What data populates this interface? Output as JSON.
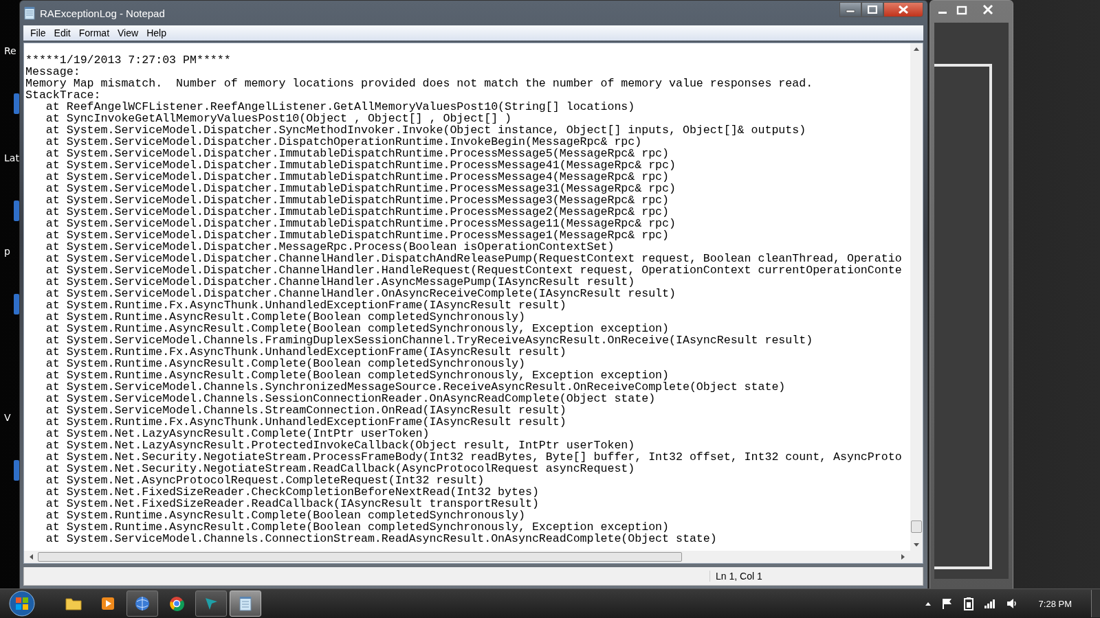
{
  "window": {
    "title": "RAExceptionLog - Notepad"
  },
  "menu": [
    "File",
    "Edit",
    "Format",
    "View",
    "Help"
  ],
  "lines": [
    "*****1/19/2013 7:27:03 PM*****",
    "Message:",
    "Memory Map mismatch.  Number of memory locations provided does not match the number of memory value responses read.",
    "StackTrace:",
    "   at ReefAngelWCFListener.ReefAngelListener.GetAllMemoryValuesPost10(String[] locations)",
    "   at SyncInvokeGetAllMemoryValuesPost10(Object , Object[] , Object[] )",
    "   at System.ServiceModel.Dispatcher.SyncMethodInvoker.Invoke(Object instance, Object[] inputs, Object[]& outputs)",
    "   at System.ServiceModel.Dispatcher.DispatchOperationRuntime.InvokeBegin(MessageRpc& rpc)",
    "   at System.ServiceModel.Dispatcher.ImmutableDispatchRuntime.ProcessMessage5(MessageRpc& rpc)",
    "   at System.ServiceModel.Dispatcher.ImmutableDispatchRuntime.ProcessMessage41(MessageRpc& rpc)",
    "   at System.ServiceModel.Dispatcher.ImmutableDispatchRuntime.ProcessMessage4(MessageRpc& rpc)",
    "   at System.ServiceModel.Dispatcher.ImmutableDispatchRuntime.ProcessMessage31(MessageRpc& rpc)",
    "   at System.ServiceModel.Dispatcher.ImmutableDispatchRuntime.ProcessMessage3(MessageRpc& rpc)",
    "   at System.ServiceModel.Dispatcher.ImmutableDispatchRuntime.ProcessMessage2(MessageRpc& rpc)",
    "   at System.ServiceModel.Dispatcher.ImmutableDispatchRuntime.ProcessMessage11(MessageRpc& rpc)",
    "   at System.ServiceModel.Dispatcher.ImmutableDispatchRuntime.ProcessMessage1(MessageRpc& rpc)",
    "   at System.ServiceModel.Dispatcher.MessageRpc.Process(Boolean isOperationContextSet)",
    "   at System.ServiceModel.Dispatcher.ChannelHandler.DispatchAndReleasePump(RequestContext request, Boolean cleanThread, Operatio",
    "   at System.ServiceModel.Dispatcher.ChannelHandler.HandleRequest(RequestContext request, OperationContext currentOperationConte",
    "   at System.ServiceModel.Dispatcher.ChannelHandler.AsyncMessagePump(IAsyncResult result)",
    "   at System.ServiceModel.Dispatcher.ChannelHandler.OnAsyncReceiveComplete(IAsyncResult result)",
    "   at System.Runtime.Fx.AsyncThunk.UnhandledExceptionFrame(IAsyncResult result)",
    "   at System.Runtime.AsyncResult.Complete(Boolean completedSynchronously)",
    "   at System.Runtime.AsyncResult.Complete(Boolean completedSynchronously, Exception exception)",
    "   at System.ServiceModel.Channels.FramingDuplexSessionChannel.TryReceiveAsyncResult.OnReceive(IAsyncResult result)",
    "   at System.Runtime.Fx.AsyncThunk.UnhandledExceptionFrame(IAsyncResult result)",
    "   at System.Runtime.AsyncResult.Complete(Boolean completedSynchronously)",
    "   at System.Runtime.AsyncResult.Complete(Boolean completedSynchronously, Exception exception)",
    "   at System.ServiceModel.Channels.SynchronizedMessageSource.ReceiveAsyncResult.OnReceiveComplete(Object state)",
    "   at System.ServiceModel.Channels.SessionConnectionReader.OnAsyncReadComplete(Object state)",
    "   at System.ServiceModel.Channels.StreamConnection.OnRead(IAsyncResult result)",
    "   at System.Runtime.Fx.AsyncThunk.UnhandledExceptionFrame(IAsyncResult result)",
    "   at System.Net.LazyAsyncResult.Complete(IntPtr userToken)",
    "   at System.Net.LazyAsyncResult.ProtectedInvokeCallback(Object result, IntPtr userToken)",
    "   at System.Net.Security.NegotiateStream.ProcessFrameBody(Int32 readBytes, Byte[] buffer, Int32 offset, Int32 count, AsyncProto",
    "   at System.Net.Security.NegotiateStream.ReadCallback(AsyncProtocolRequest asyncRequest)",
    "   at System.Net.AsyncProtocolRequest.CompleteRequest(Int32 result)",
    "   at System.Net.FixedSizeReader.CheckCompletionBeforeNextRead(Int32 bytes)",
    "   at System.Net.FixedSizeReader.ReadCallback(IAsyncResult transportResult)",
    "   at System.Runtime.AsyncResult.Complete(Boolean completedSynchronously)",
    "   at System.Runtime.AsyncResult.Complete(Boolean completedSynchronously, Exception exception)",
    "   at System.ServiceModel.Channels.ConnectionStream.ReadAsyncResult.OnAsyncReadComplete(Object state)"
  ],
  "status_bar": {
    "position": "Ln 1, Col 1"
  },
  "desktop_labels": [
    "Re",
    "Lat",
    "p",
    "V"
  ],
  "taskbar": {
    "apps": [
      {
        "kind": "folder",
        "running": false,
        "selected": false
      },
      {
        "kind": "media",
        "running": false,
        "selected": false
      },
      {
        "kind": "globe",
        "running": true,
        "selected": false
      },
      {
        "kind": "browser",
        "running": false,
        "selected": false
      },
      {
        "kind": "arrow",
        "running": true,
        "selected": false
      },
      {
        "kind": "notepad",
        "running": true,
        "selected": true
      }
    ],
    "clock": "7:28 PM"
  }
}
